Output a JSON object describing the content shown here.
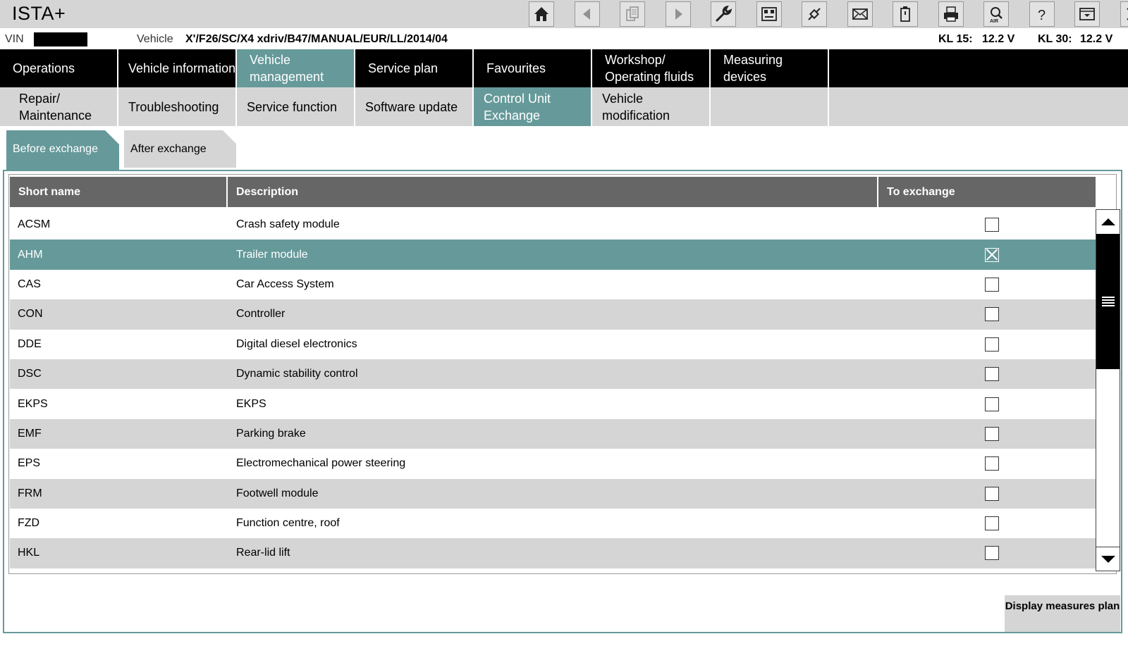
{
  "app": {
    "title": "ISTA+"
  },
  "toolbar": [
    {
      "icon": "home-icon",
      "enabled": true
    },
    {
      "icon": "arrow-left-icon",
      "enabled": false
    },
    {
      "icon": "documents-icon",
      "enabled": false
    },
    {
      "icon": "arrow-right-icon",
      "enabled": false
    },
    {
      "icon": "wrench-icon",
      "enabled": true
    },
    {
      "icon": "control-unit-icon",
      "enabled": true
    },
    {
      "icon": "connection-icon",
      "enabled": true
    },
    {
      "icon": "mail-icon",
      "enabled": true
    },
    {
      "icon": "battery-icon",
      "enabled": true
    },
    {
      "icon": "print-icon",
      "enabled": true
    },
    {
      "icon": "air-search-icon",
      "enabled": true
    },
    {
      "icon": "help-icon",
      "enabled": true
    },
    {
      "icon": "minimize-icon",
      "enabled": true
    },
    {
      "icon": "close-icon",
      "enabled": true
    }
  ],
  "info": {
    "vin_label": "VIN",
    "vehicle_label": "Vehicle",
    "vehicle_value": "X'/F26/SC/X4 xdriv/B47/MANUAL/EUR/LL/2014/04",
    "kl15_label": "KL 15:",
    "kl15_value": "12.2 V",
    "kl30_label": "KL 30:",
    "kl30_value": "12.2 V"
  },
  "mainnav": {
    "operations": "Operations",
    "vehicle_information": "Vehicle information",
    "vehicle_management": "Vehicle management",
    "service_plan": "Service plan",
    "favourites": "Favourites",
    "workshop": "Workshop/ Operating fluids",
    "measuring": "Measuring devices"
  },
  "subnav": {
    "repair": "Repair/ Maintenance",
    "troubleshooting": "Troubleshooting",
    "service_function": "Service function",
    "software_update": "Software update",
    "control_unit_exchange": "Control Unit Exchange",
    "vehicle_modification": "Vehicle modification"
  },
  "tabs": {
    "before": "Before exchange",
    "after": "After exchange"
  },
  "table": {
    "headers": {
      "short_name": "Short name",
      "description": "Description",
      "to_exchange": "To exchange"
    },
    "rows": [
      {
        "short": "ACSM",
        "desc": "Crash safety module",
        "checked": false,
        "selected": false
      },
      {
        "short": "AHM",
        "desc": "Trailer module",
        "checked": true,
        "selected": true
      },
      {
        "short": "CAS",
        "desc": "Car Access System",
        "checked": false,
        "selected": false
      },
      {
        "short": "CON",
        "desc": "Controller",
        "checked": false,
        "selected": false
      },
      {
        "short": "DDE",
        "desc": "Digital diesel electronics",
        "checked": false,
        "selected": false
      },
      {
        "short": "DSC",
        "desc": "Dynamic stability control",
        "checked": false,
        "selected": false
      },
      {
        "short": "EKPS",
        "desc": "EKPS",
        "checked": false,
        "selected": false
      },
      {
        "short": "EMF",
        "desc": "Parking brake",
        "checked": false,
        "selected": false
      },
      {
        "short": "EPS",
        "desc": "Electromechanical power steering",
        "checked": false,
        "selected": false
      },
      {
        "short": "FRM",
        "desc": "Footwell module",
        "checked": false,
        "selected": false
      },
      {
        "short": "FZD",
        "desc": "Function centre, roof",
        "checked": false,
        "selected": false
      },
      {
        "short": "HKL",
        "desc": "Rear-lid lift",
        "checked": false,
        "selected": false
      }
    ]
  },
  "buttons": {
    "display_measures_plan": "Display measures plan"
  },
  "colors": {
    "accent": "#66999a",
    "header_bg": "#666666",
    "nav_bg": "#000000",
    "light_gray": "#d5d5d5"
  }
}
